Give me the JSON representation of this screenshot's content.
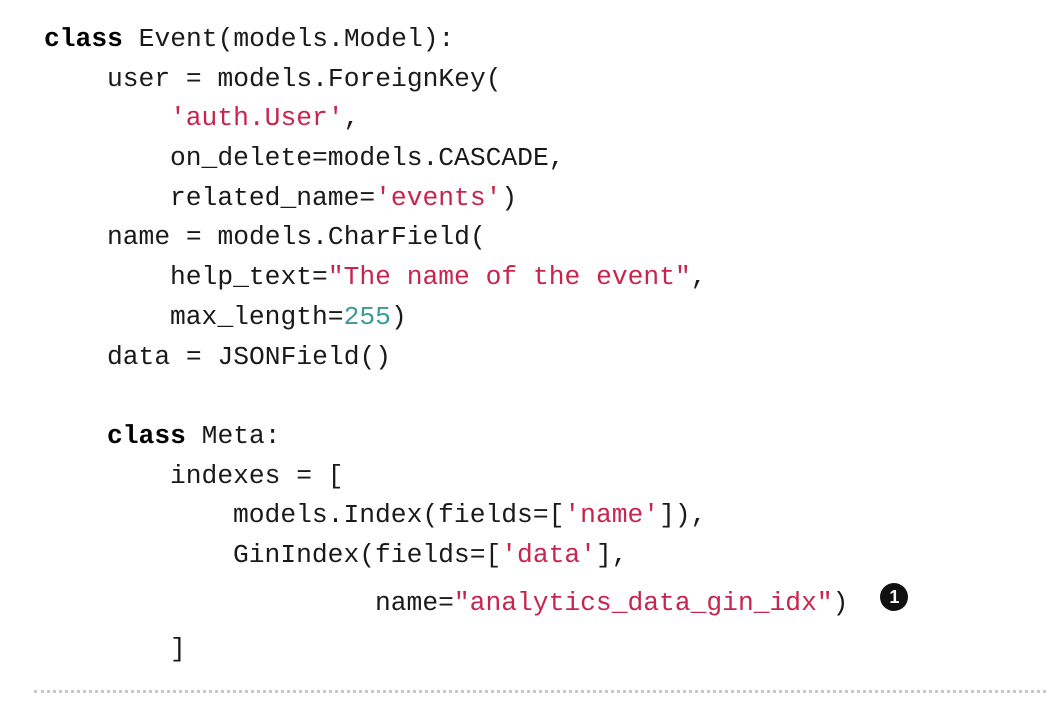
{
  "code": {
    "l1_kw": "class",
    "l1_rest": " Event(models.Model):",
    "l2": "user = models.ForeignKey(",
    "l3_str": "'auth.User'",
    "l3_rest": ",",
    "l4": "on_delete=models.CASCADE,",
    "l5_pre": "related_name=",
    "l5_str": "'events'",
    "l5_post": ")",
    "l6": "name = models.CharField(",
    "l7_pre": "help_text=",
    "l7_str": "\"The name of the event\"",
    "l7_post": ",",
    "l8_pre": "max_length=",
    "l8_num": "255",
    "l8_post": ")",
    "l9": "data = JSONField()",
    "l11_kw": "class",
    "l11_rest": " Meta:",
    "l12": "indexes = [",
    "l13_pre": "models.Index(fields=[",
    "l13_str": "'name'",
    "l13_post": "]),",
    "l14_pre": "GinIndex(fields=[",
    "l14_str": "'data'",
    "l14_post": "],",
    "l15_pre": "name=",
    "l15_str": "\"analytics_data_gin_idx\"",
    "l15_post": ")",
    "l16": "]"
  },
  "callout": {
    "number": "1"
  }
}
